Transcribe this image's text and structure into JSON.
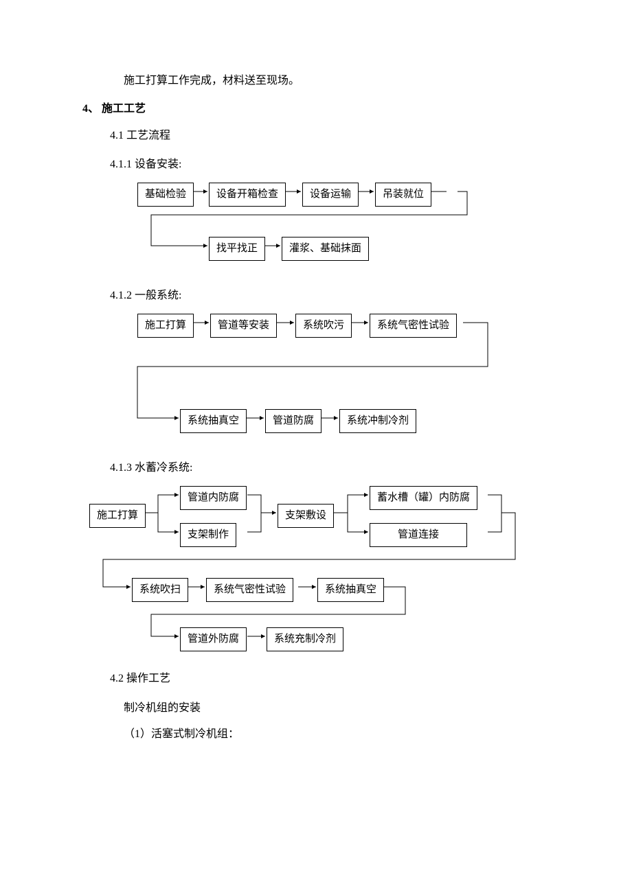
{
  "intro": "施工打算工作完成，材料送至现场。",
  "h4": "4、 施工工艺",
  "s41": "4.1  工艺流程",
  "s411": "4.1.1  设备安装:",
  "f1": {
    "b1": "基础检验",
    "b2": "设备开箱检查",
    "b3": "设备运输",
    "b4": "吊装就位",
    "b5": "找平找正",
    "b6": "灌浆、基础抹面"
  },
  "s412": "4.1.2  一般系统:",
  "f2": {
    "b1": "施工打算",
    "b2": "管道等安装",
    "b3": "系统吹污",
    "b4": "系统气密性试验",
    "b5": "系统抽真空",
    "b6": "管道防腐",
    "b7": "系统冲制冷剂"
  },
  "s413": "4.1.3  水蓄冷系统:",
  "f3": {
    "b1": "施工打算",
    "b2": "管道内防腐",
    "b3": "支架制作",
    "b4": "支架敷设",
    "b5": "蓄水槽（罐）内防腐",
    "b6": "管道连接",
    "b7": "系统吹扫",
    "b8": "系统气密性试验",
    "b9": "系统抽真空",
    "b10": "管道外防腐",
    "b11": "系统充制冷剂"
  },
  "s42": "4.2  操作工艺",
  "p421": "制冷机组的安装",
  "p422": "（1）活塞式制冷机组："
}
